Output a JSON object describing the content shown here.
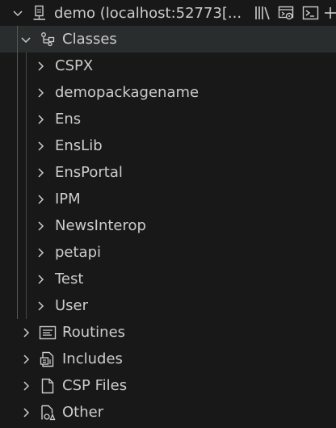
{
  "root": {
    "label": "demo (localhost:52773[...",
    "icon": "server-icon",
    "actions": [
      "library-icon",
      "server-settings-icon",
      "terminal-icon",
      "add-icon"
    ]
  },
  "classes_folder": {
    "label": "Classes",
    "icon": "class-hierarchy-icon"
  },
  "packages": [
    "CSPX",
    "demopackagename",
    "Ens",
    "EnsLib",
    "EnsPortal",
    "IPM",
    "NewsInterop",
    "petapi",
    "Test",
    "User"
  ],
  "folders": [
    {
      "label": "Routines",
      "icon": "routine-icon"
    },
    {
      "label": "Includes",
      "icon": "include-file-icon"
    },
    {
      "label": "CSP Files",
      "icon": "file-icon"
    },
    {
      "label": "Other",
      "icon": "other-files-icon"
    }
  ],
  "colors": {
    "background": "#181818",
    "selected_row": "#2a2d2e",
    "text": "#cccccc",
    "indent_guide": "#585858"
  }
}
